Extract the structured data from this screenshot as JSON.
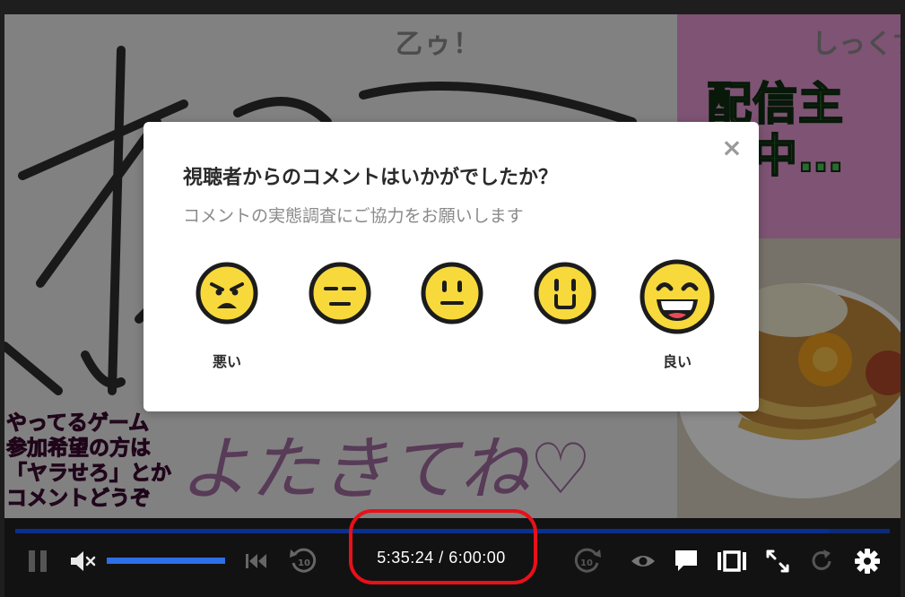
{
  "stage": {
    "top_title": "乙ゥ！",
    "top_right_text": "しっくす",
    "status_line1": "配信主",
    "status_line2": "席中…",
    "game_text": "やってるゲーム\n参加希望の方は\n「ヤラせろ」とか\nコメントどうぞ",
    "handwritten_bottom": "よたきてね♡"
  },
  "modal": {
    "title": "視聴者からのコメントはいかがでしたか？",
    "subtitle": "コメントの実態調査にご協力をお願いします",
    "close_symbol": "×",
    "ratings": [
      {
        "label": "悪い",
        "icon": "angry-face-icon"
      },
      {
        "label": "",
        "icon": "expressionless-face-icon"
      },
      {
        "label": "",
        "icon": "neutral-face-icon"
      },
      {
        "label": "",
        "icon": "slight-smile-face-icon"
      },
      {
        "label": "良い",
        "icon": "grinning-face-icon"
      }
    ]
  },
  "controls": {
    "time_display": "5:35:24 / 6:00:00",
    "progress": 0.93,
    "volume": 1.0,
    "muted": true,
    "icons": [
      "pause-icon",
      "mute-icon",
      "skip-back-icon",
      "rewind-10-icon",
      "forward-10-icon",
      "eye-icon",
      "comment-icon",
      "frame-icon",
      "fullscreen-icon",
      "reload-icon",
      "settings-icon"
    ]
  },
  "colors": {
    "accent_blue": "#2d6fe6",
    "emoji_yellow": "#f7d93c",
    "highlight_red": "#e8101a"
  }
}
